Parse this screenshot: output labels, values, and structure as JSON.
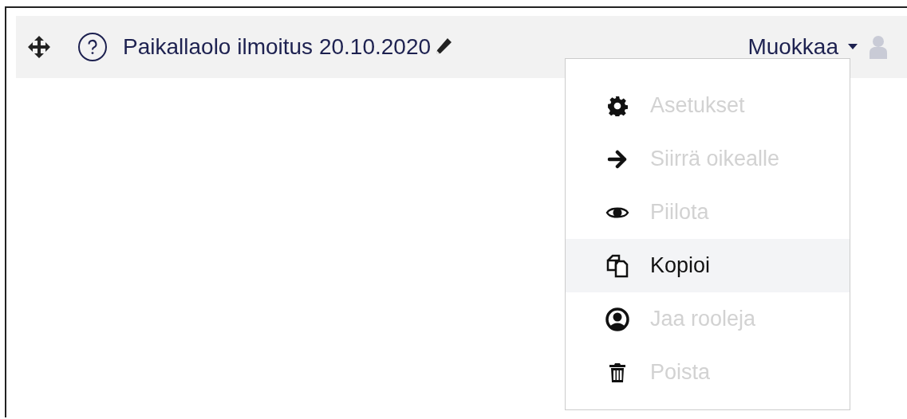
{
  "header": {
    "title": "Paikallaolo ilmoitus 20.10.2020",
    "edit_menu": {
      "label": "Muokkaa",
      "expanded": true
    }
  },
  "menu": {
    "items": [
      {
        "kind": "gear",
        "label": "Asetukset",
        "disabled": true,
        "selected": false
      },
      {
        "kind": "arrow",
        "label": "Siirrä oikealle",
        "disabled": true,
        "selected": false
      },
      {
        "kind": "eye",
        "label": "Piilota",
        "disabled": true,
        "selected": false
      },
      {
        "kind": "copy",
        "label": "Kopioi",
        "disabled": false,
        "selected": true
      },
      {
        "kind": "user",
        "label": "Jaa rooleja",
        "disabled": true,
        "selected": false
      },
      {
        "kind": "trash",
        "label": "Poista",
        "disabled": true,
        "selected": false
      }
    ]
  }
}
